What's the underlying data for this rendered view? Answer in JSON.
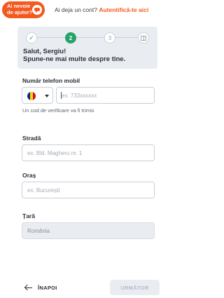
{
  "topbar": {
    "help_label": "Ai nevoie de ajutor?",
    "account_question": "Ai deja un cont?",
    "login_link": "Autentifică-te aici"
  },
  "stepper": {
    "current_step": 2,
    "steps": [
      {
        "label": "✓",
        "state": "done"
      },
      {
        "label": "2",
        "state": "current"
      },
      {
        "label": "3",
        "state": "todo"
      },
      {
        "label": "",
        "state": "todo",
        "icon": "gift-icon"
      }
    ]
  },
  "header": {
    "greeting_line1": "Salut, Sergiu!",
    "greeting_line2": "Spune-ne mai multe despre tine."
  },
  "form": {
    "phone": {
      "label": "Număr telefon mobil",
      "country_flag": "romania-flag-icon",
      "placeholder": "ex. 733xxxxxx",
      "value": "",
      "hint": "Un cod de verificare va fi trimis"
    },
    "street": {
      "label": "Stradă",
      "placeholder": "ex. Bld. Magheru nr. 1",
      "value": ""
    },
    "city": {
      "label": "Oraș",
      "placeholder": "ex. București",
      "value": ""
    },
    "country": {
      "label": "Țară",
      "value": "România"
    }
  },
  "footer": {
    "back_label": "ÎNAPOI",
    "next_label": "URMĂTOR"
  },
  "colors": {
    "accent": "#f35a1f",
    "step_green": "#27a36a",
    "panel_bg": "#e9edf2",
    "flag_blue": "#002b7f",
    "flag_yellow": "#fcd116",
    "flag_red": "#ce1126"
  }
}
